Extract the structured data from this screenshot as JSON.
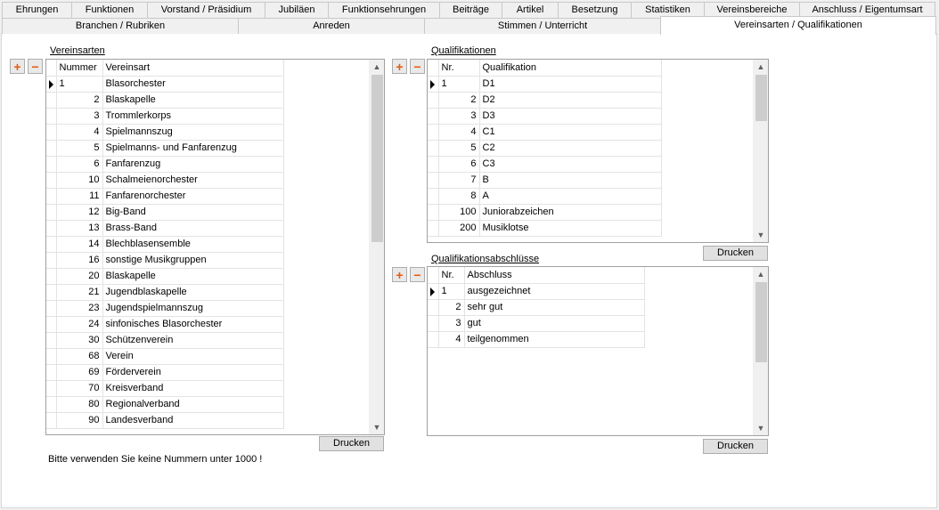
{
  "tabs_row1": [
    "Ehrungen",
    "Funktionen",
    "Vorstand / Präsidium",
    "Jubiläen",
    "Funktionsehrungen",
    "Beiträge",
    "Artikel",
    "Besetzung",
    "Statistiken",
    "Vereinsbereiche",
    "Anschluss / Eigentumsart"
  ],
  "tabs_row2": [
    "Branchen / Rubriken",
    "Anreden",
    "Stimmen / Unterricht",
    "Vereinsarten / Qualifikationen"
  ],
  "active_tab": "Vereinsarten / Qualifikationen",
  "vereinsarten": {
    "label": "Vereinsarten",
    "columns": [
      "Nummer",
      "Vereinsart"
    ],
    "rows": [
      [
        "1",
        "Blasorchester"
      ],
      [
        "2",
        "Blaskapelle"
      ],
      [
        "3",
        "Trommlerkorps"
      ],
      [
        "4",
        "Spielmannszug"
      ],
      [
        "5",
        "Spielmanns- und Fanfarenzug"
      ],
      [
        "6",
        "Fanfarenzug"
      ],
      [
        "10",
        "Schalmeienorchester"
      ],
      [
        "11",
        "Fanfarenorchester"
      ],
      [
        "12",
        "Big-Band"
      ],
      [
        "13",
        "Brass-Band"
      ],
      [
        "14",
        "Blechblasensemble"
      ],
      [
        "16",
        "sonstige Musikgruppen"
      ],
      [
        "20",
        "Blaskapelle"
      ],
      [
        "21",
        "Jugendblaskapelle"
      ],
      [
        "23",
        "Jugendspielmannszug"
      ],
      [
        "24",
        "sinfonisches Blasorchester"
      ],
      [
        "30",
        "Schützenverein"
      ],
      [
        "68",
        "Verein"
      ],
      [
        "69",
        "Förderverein"
      ],
      [
        "70",
        "Kreisverband"
      ],
      [
        "80",
        "Regionalverband"
      ],
      [
        "90",
        "Landesverband"
      ]
    ],
    "print_label": "Drucken",
    "hint": "Bitte verwenden Sie keine Nummern unter 1000 !"
  },
  "qualifikationen": {
    "label": "Qualifikationen",
    "columns": [
      "Nr.",
      "Qualifikation"
    ],
    "rows": [
      [
        "1",
        "D1"
      ],
      [
        "2",
        "D2"
      ],
      [
        "3",
        "D3"
      ],
      [
        "4",
        "C1"
      ],
      [
        "5",
        "C2"
      ],
      [
        "6",
        "C3"
      ],
      [
        "7",
        "B"
      ],
      [
        "8",
        "A"
      ],
      [
        "100",
        "Juniorabzeichen"
      ],
      [
        "200",
        "Musiklotse"
      ]
    ],
    "print_label": "Drucken"
  },
  "abschluesse": {
    "label": "Qualifikationsabschlüsse",
    "columns": [
      "Nr.",
      "Abschluss"
    ],
    "rows": [
      [
        "1",
        "ausgezeichnet"
      ],
      [
        "2",
        "sehr gut"
      ],
      [
        "3",
        "gut"
      ],
      [
        "4",
        "teilgenommen"
      ]
    ],
    "print_label": "Drucken"
  },
  "icons": {
    "add": "plus-icon",
    "remove": "minus-icon",
    "row_pointer": "row-pointer-icon"
  },
  "colors": {
    "accent": "#e8590c",
    "grid_border": "#a0a0a0"
  }
}
